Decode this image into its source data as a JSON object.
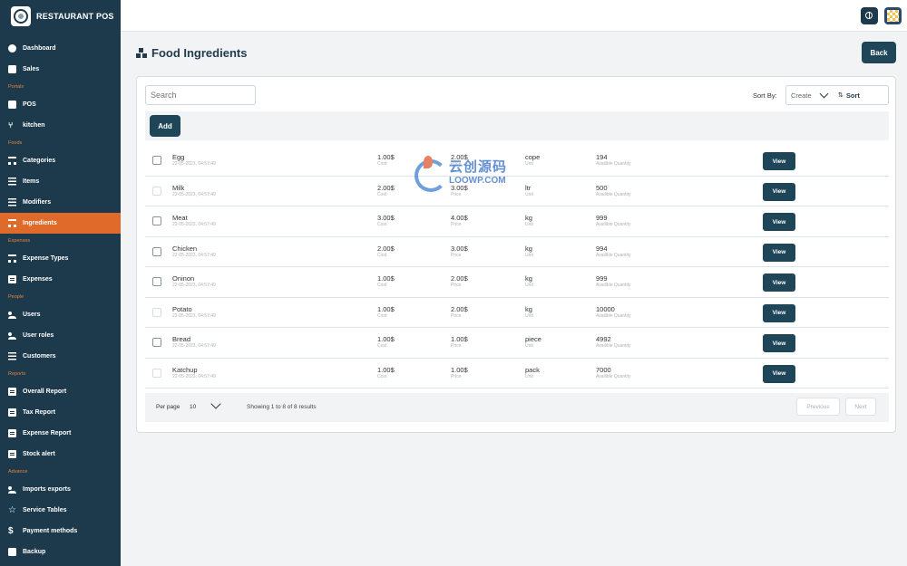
{
  "brand": {
    "title": "RESTAURANT POS"
  },
  "sidebar": {
    "items": [
      {
        "label": "Dashboard",
        "icon": "dashboard-icon",
        "section": ""
      },
      {
        "label": "Sales",
        "icon": "sales-icon",
        "section": ""
      },
      {
        "label": "POS",
        "icon": "pos-icon",
        "section": "Portals"
      },
      {
        "label": "kitchen",
        "icon": "kitchen-icon",
        "section": ""
      },
      {
        "label": "Categories",
        "icon": "categories-icon",
        "section": "Foods"
      },
      {
        "label": "Items",
        "icon": "items-icon",
        "section": ""
      },
      {
        "label": "Modifiers",
        "icon": "modifiers-icon",
        "section": ""
      },
      {
        "label": "Ingredients",
        "icon": "ingredients-icon",
        "section": "",
        "active": true
      },
      {
        "label": "Expense Types",
        "icon": "expense-types-icon",
        "section": "Expenses"
      },
      {
        "label": "Expenses",
        "icon": "expenses-icon",
        "section": ""
      },
      {
        "label": "Users",
        "icon": "users-icon",
        "section": "People"
      },
      {
        "label": "User roles",
        "icon": "user-roles-icon",
        "section": ""
      },
      {
        "label": "Customers",
        "icon": "customers-icon",
        "section": ""
      },
      {
        "label": "Overall Report",
        "icon": "report-icon",
        "section": "Reports"
      },
      {
        "label": "Tax Report",
        "icon": "report-icon",
        "section": ""
      },
      {
        "label": "Expense Report",
        "icon": "report-icon",
        "section": ""
      },
      {
        "label": "Stock alert",
        "icon": "report-icon",
        "section": ""
      },
      {
        "label": "Imports exports",
        "icon": "imports-exports-icon",
        "section": "Advance"
      },
      {
        "label": "Service Tables",
        "icon": "star-icon",
        "section": ""
      },
      {
        "label": "Payment methods",
        "icon": "dollar-icon",
        "section": ""
      },
      {
        "label": "Backup",
        "icon": "database-icon",
        "section": ""
      }
    ]
  },
  "header": {
    "title": "Food Ingredients",
    "back_label": "Back"
  },
  "toolbar": {
    "search_placeholder": "Search",
    "sort_by_label": "Sort By:",
    "sort_value": "Create",
    "sort_button_label": "Sort",
    "add_label": "Add"
  },
  "table": {
    "labels": {
      "cost": "Cost",
      "price": "Price",
      "unit": "Unit",
      "qty": "Availible Quantity",
      "view": "View"
    },
    "rows": [
      {
        "name": "Egg",
        "date": "22-05-2023, 04:57:49",
        "cost": "1.00$",
        "price": "2.00$",
        "unit": "cope",
        "qty": "194",
        "checkbox_enabled": true
      },
      {
        "name": "Milk",
        "date": "22-05-2023, 04:57:49",
        "cost": "2.00$",
        "price": "3.00$",
        "unit": "ltr",
        "qty": "500",
        "checkbox_enabled": false
      },
      {
        "name": "Meat",
        "date": "22-05-2023, 04:57:49",
        "cost": "3.00$",
        "price": "4.00$",
        "unit": "kg",
        "qty": "999",
        "checkbox_enabled": true
      },
      {
        "name": "Chicken",
        "date": "22-05-2023, 04:57:49",
        "cost": "2.00$",
        "price": "3.00$",
        "unit": "kg",
        "qty": "994",
        "checkbox_enabled": true
      },
      {
        "name": "Oninon",
        "date": "22-05-2023, 04:57:49",
        "cost": "1.00$",
        "price": "2.00$",
        "unit": "kg",
        "qty": "999",
        "checkbox_enabled": true
      },
      {
        "name": "Potato",
        "date": "22-05-2023, 04:57:49",
        "cost": "1.00$",
        "price": "2.00$",
        "unit": "kg",
        "qty": "10000",
        "checkbox_enabled": false
      },
      {
        "name": "Bread",
        "date": "22-05-2023, 04:57:49",
        "cost": "1.00$",
        "price": "1.00$",
        "unit": "piece",
        "qty": "4992",
        "checkbox_enabled": true
      },
      {
        "name": "Katchup",
        "date": "22-05-2023, 04:57:49",
        "cost": "1.00$",
        "price": "1.00$",
        "unit": "pack",
        "qty": "7000",
        "checkbox_enabled": false
      }
    ]
  },
  "pagination": {
    "per_page_label": "Per page",
    "per_page_value": "10",
    "showing": "Showing 1 to 8 of 8 results",
    "previous_label": "Previous",
    "next_label": "Next"
  },
  "watermark": {
    "cn": "云创源码",
    "en": "LOOWP.COM"
  },
  "colors": {
    "sidebar": "#1c3a4c",
    "accent": "#e06a2a",
    "primary_button": "#1f4559"
  }
}
